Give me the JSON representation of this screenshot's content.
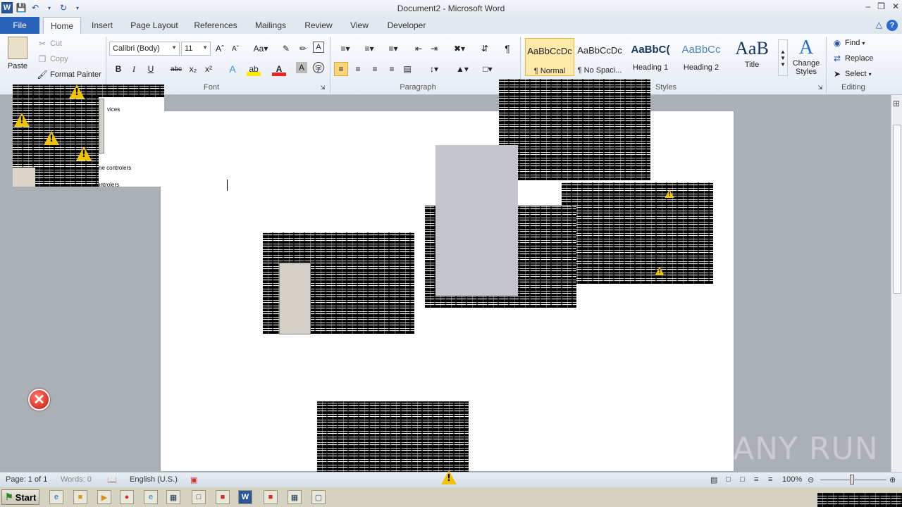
{
  "app": {
    "title": "Document2 - Microsoft Word"
  },
  "tabs": [
    {
      "label": "File"
    },
    {
      "label": "Home"
    },
    {
      "label": "Insert"
    },
    {
      "label": "Page Layout"
    },
    {
      "label": "References"
    },
    {
      "label": "Mailings"
    },
    {
      "label": "Review"
    },
    {
      "label": "View"
    },
    {
      "label": "Developer"
    }
  ],
  "clipboard": {
    "paste": "Paste",
    "cut": "Cut",
    "copy": "Copy",
    "format_painter": "Format Painter"
  },
  "font": {
    "name": "Calibri (Body)",
    "size": "11",
    "group_label": "Font"
  },
  "paragraph": {
    "group_label": "Paragraph"
  },
  "styles": {
    "group_label": "Styles",
    "items": [
      {
        "preview": "AaBbCcDc",
        "label": "¶ Normal"
      },
      {
        "preview": "AaBbCcDc",
        "label": "¶ No Spaci..."
      },
      {
        "preview": "AaBbC(",
        "label": "Heading 1"
      },
      {
        "preview": "AaBbCc",
        "label": "Heading 2"
      },
      {
        "preview": "AaB",
        "label": "Title"
      }
    ],
    "change_styles": "Change Styles"
  },
  "editing": {
    "group_label": "Editing",
    "find": "Find",
    "replace": "Replace",
    "select": "Select"
  },
  "glitch_text": {
    "a": "vices",
    "b": "ne controlers",
    "c": "controlers"
  },
  "status": {
    "page": "Page: 1 of 1",
    "words": "Words: 0",
    "language": "English (U.S.)",
    "zoom": "100%"
  },
  "taskbar": {
    "start": "Start"
  },
  "watermark": "ANY RUN",
  "colors": {
    "file_tab": "#2b62ba",
    "accent": "#2a5699",
    "error": "#d3241a",
    "warning": "#f0c30b"
  }
}
